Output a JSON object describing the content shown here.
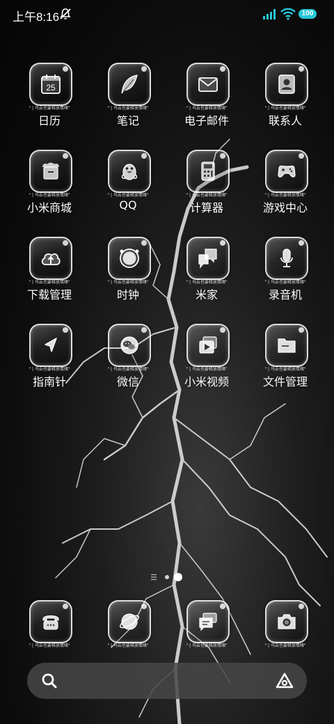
{
  "status_bar": {
    "time": "上午8:16",
    "battery": "100",
    "icons": [
      "mute-icon",
      "signal-icon",
      "wifi-icon",
      "battery-icon"
    ]
  },
  "icon_tag": "\" | 乌云也要释放情绪\"",
  "apps": [
    {
      "label": "日历",
      "icon": "calendar-icon",
      "calendar_day": "25"
    },
    {
      "label": "笔记",
      "icon": "feather-icon"
    },
    {
      "label": "电子邮件",
      "icon": "mail-icon"
    },
    {
      "label": "联系人",
      "icon": "contact-icon"
    },
    {
      "label": "小米商城",
      "icon": "shop-icon"
    },
    {
      "label": "QQ",
      "icon": "penguin-icon"
    },
    {
      "label": "计算器",
      "icon": "calculator-icon"
    },
    {
      "label": "游戏中心",
      "icon": "gamepad-icon"
    },
    {
      "label": "下载管理",
      "icon": "cloud-download-icon"
    },
    {
      "label": "时钟",
      "icon": "clock-icon"
    },
    {
      "label": "米家",
      "icon": "chat-bubbles-icon"
    },
    {
      "label": "录音机",
      "icon": "microphone-icon"
    },
    {
      "label": "指南针",
      "icon": "compass-icon"
    },
    {
      "label": "微信",
      "icon": "wechat-icon"
    },
    {
      "label": "小米视频",
      "icon": "video-icon"
    },
    {
      "label": "文件管理",
      "icon": "folder-icon"
    }
  ],
  "dock": [
    {
      "icon": "phone-icon"
    },
    {
      "icon": "browser-icon"
    },
    {
      "icon": "messages-icon"
    },
    {
      "icon": "camera-icon"
    }
  ],
  "page_indicator": {
    "pages": 2,
    "current": 2
  },
  "search_bar": {
    "icons": [
      "search-icon",
      "assistant-icon"
    ]
  }
}
